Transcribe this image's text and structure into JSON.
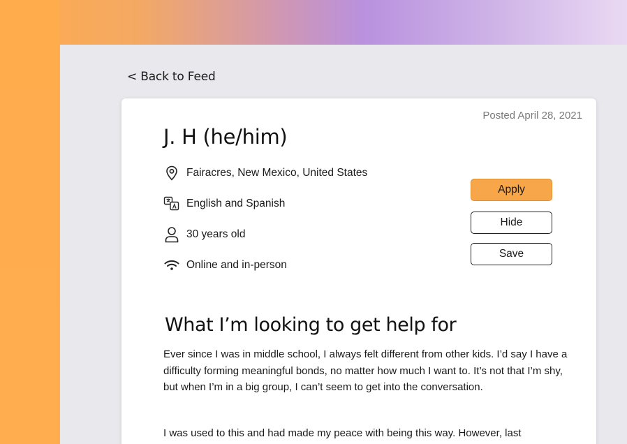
{
  "nav": {
    "back_label": "< Back to Feed"
  },
  "post": {
    "posted": "Posted April 28, 2021",
    "name": "J. H (he/him)",
    "details": {
      "location": "Fairacres, New Mexico, United States",
      "languages": "English and Spanish",
      "age": "30 years old",
      "mode": "Online and in-person"
    },
    "actions": {
      "apply": "Apply",
      "hide": "Hide",
      "save": "Save"
    },
    "section_title": "What I’m looking to get help for",
    "paragraphs": [
      "Ever since I was in middle school, I always felt different from other kids. I’d say I have a difficulty forming meaningful bonds, no matter how much I want to. It’s not that I’m shy, but when I’m in a big group, I can’t seem to get into the conversation.",
      "I was used to this and had made my peace with being this way. However, last"
    ]
  },
  "colors": {
    "accent": "#f7a64a",
    "panel": "#e8e8ed"
  },
  "icons": {
    "location": "map-pin-icon",
    "language": "translate-icon",
    "age": "person-icon",
    "mode": "wifi-icon"
  }
}
